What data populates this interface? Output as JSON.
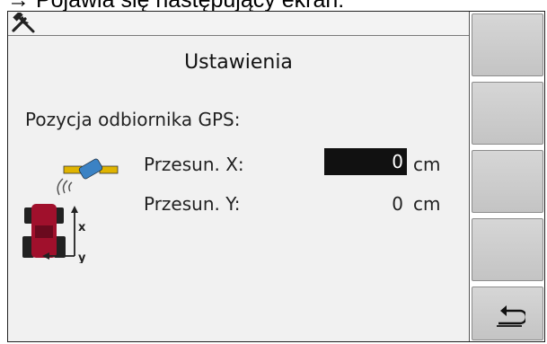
{
  "caption": "→ Pojawia się następujący ekran:",
  "screen": {
    "title": "Ustawienia",
    "section_label": "Pozycja odbiornika GPS:",
    "rows": [
      {
        "label": "Przesun. X:",
        "value": "0",
        "unit": "cm",
        "selected": true
      },
      {
        "label": "Przesun. Y:",
        "value": "0",
        "unit": "cm",
        "selected": false
      }
    ],
    "axis_labels": {
      "x": "x",
      "y": "y"
    }
  },
  "icons": {
    "header": "tools-icon",
    "illustration": "gps-receiver-tractor-icon",
    "softkey_back": "return-arrow-icon"
  },
  "colors": {
    "tractor": "#a0102c",
    "selected_field_bg": "#111111",
    "softkey": "#cfcfcf"
  }
}
